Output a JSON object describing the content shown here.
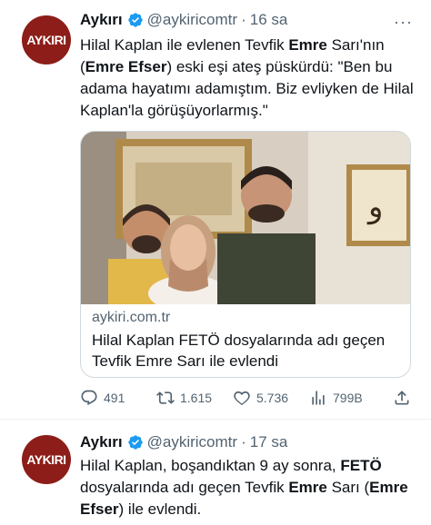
{
  "tweets": [
    {
      "avatar_logo_text": "AYKIRI",
      "name": "Aykırı",
      "handle": "@aykiricomtr",
      "dot": "·",
      "time": "16 sa",
      "more": "···",
      "text_parts": [
        "Hilal Kaplan ile evlenen Tevfik ",
        "Emre",
        " Sarı'nın (",
        "Emre Efser",
        ") eski eşi ateş püskürdü: \"Ben bu adama hayatımı adamıştım. Biz evliyken de Hilal Kaplan'la görüşüyorlarmış.\""
      ],
      "card": {
        "domain": "aykiri.com.tr",
        "title": "Hilal Kaplan FETÖ dosyalarında adı geçen Tevfik Emre Sarı ile evlendi"
      },
      "stats": {
        "replies": "491",
        "retweets": "1.615",
        "likes": "5.736",
        "views": "799B"
      }
    },
    {
      "avatar_logo_text": "AYKIRI",
      "name": "Aykırı",
      "handle": "@aykiricomtr",
      "dot": "·",
      "time": "17 sa",
      "text_parts": [
        "Hilal Kaplan, boşandıktan 9 ay sonra, ",
        "FETÖ",
        " dosyalarında adı geçen Tevfik ",
        "Emre",
        " Sarı (",
        "Emre Efser",
        ") ile evlendi."
      ]
    }
  ],
  "colors": {
    "avatar_bg": "#8c1d18",
    "verified": "#1d9bf0",
    "secondary_text": "#536471"
  },
  "icons": [
    "verified-badge-icon",
    "reply-icon",
    "retweet-icon",
    "like-icon",
    "views-icon",
    "share-icon",
    "more-icon"
  ]
}
